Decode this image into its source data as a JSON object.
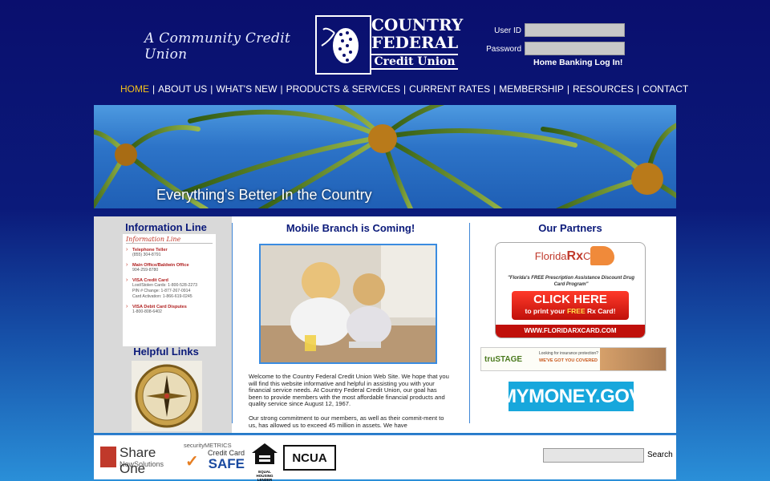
{
  "header": {
    "tagline": "A Community Credit Union",
    "logo": {
      "line1": "COUNTRY",
      "line2": "FEDERAL",
      "line3": "Credit Union"
    },
    "login": {
      "user_id_label": "User ID",
      "password_label": "Password",
      "link_label": "Home Banking Log In!"
    }
  },
  "nav": {
    "items": [
      "HOME",
      "ABOUT US",
      "WHAT'S NEW",
      "PRODUCTS & SERVICES",
      "CURRENT RATES",
      "MEMBERSHIP",
      "RESOURCES",
      "CONTACT"
    ],
    "active": "HOME",
    "separator": "|"
  },
  "banner": {
    "slogan": "Everything's Better In the Country"
  },
  "left_col": {
    "info_title": "Information Line",
    "card": {
      "title": "Information Line",
      "sections": [
        {
          "heading": "Telephone Teller",
          "lines": [
            "(855) 304-8791"
          ]
        },
        {
          "heading": "Main Office/Baldwin Office",
          "lines": [
            "904-259-8780"
          ]
        },
        {
          "heading": "VISA Credit Card",
          "lines": [
            "Lost/Stolen Cards: 1-800-528-2273",
            "PIN # Change: 1-877-267-0914",
            "Card Activation: 1-866-619-0245"
          ]
        },
        {
          "heading": "VISA Debit Card Disputes",
          "lines": [
            "1-800-808-6402"
          ]
        }
      ]
    },
    "links_title": "Helpful Links"
  },
  "middle_col": {
    "title": "Mobile Branch is Coming!",
    "paragraphs": [
      "Welcome to the Country Federal Credit Union Web Site. We hope that you will find this website informative and helpful in assisting you with your financial service needs. At Country Federal Credit Union, our goal has been to provide members with the most affordable financial products and quality service since August 12, 1967.",
      "Our strong commitment to our members, as well as their commit-ment to us, has allowed us to exceed 45 million in assets. We have"
    ]
  },
  "right_col": {
    "title": "Our Partners",
    "rx": {
      "brand_a": "Florida",
      "brand_b": "Rx",
      "brand_c": "Card",
      "tagline": "\"Florida's FREE Prescription Assistance Discount Drug Card Program\"",
      "cta_1": "CLICK HERE",
      "cta_2a": "to print your ",
      "cta_2b": "FREE",
      "cta_2c": " Rx Card!",
      "url": "WWW.FLORIDARXCARD.COM"
    },
    "trustage": {
      "brand": "truSTAGE",
      "text1": "Looking for insurance protection?",
      "text2": "WE'VE GOT YOU COVERED"
    },
    "mymoney": "MYMONEY.GOV"
  },
  "footer": {
    "share_one": {
      "l1": "Share One",
      "l2": "NewSolutions"
    },
    "security": {
      "l1": "securityMETRICS",
      "l2": "Credit Card",
      "l3": "SAFE"
    },
    "housing": "EQUAL HOUSING LENDER",
    "ncua": "NCUA",
    "search_label": "Search"
  },
  "colors": {
    "nav_active": "#f3c01a",
    "heading": "#0b1a7a",
    "accent_blue": "#3f86d6",
    "alert_red": "#b02020"
  }
}
